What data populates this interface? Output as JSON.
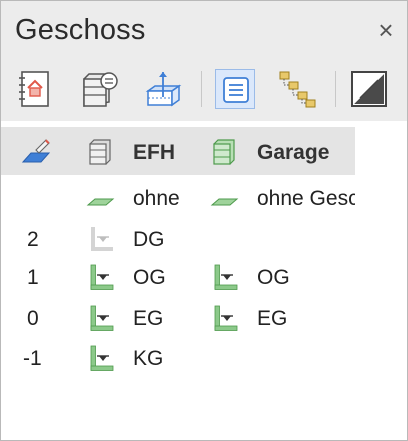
{
  "panel": {
    "title": "Geschoss",
    "close_icon": "×"
  },
  "toolbar": {
    "buttons": [
      {
        "name": "building-book-icon"
      },
      {
        "name": "floor-settings-icon"
      },
      {
        "name": "floor-height-icon"
      },
      {
        "name": "list-view-icon",
        "active": true
      },
      {
        "name": "tree-view-icon"
      },
      {
        "name": "contrast-icon"
      }
    ]
  },
  "columns": {
    "pencil_icon": "pencil-plane-icon",
    "col1": {
      "label": "EFH",
      "icon": "building-gray-icon"
    },
    "col2": {
      "label": "Garage",
      "icon": "building-green-icon"
    }
  },
  "rows": [
    {
      "number": "",
      "col1": "ohne",
      "col2": "ohne Geschoss"
    },
    {
      "number": "2",
      "col1": "DG",
      "col2": ""
    },
    {
      "number": "1",
      "col1": "OG",
      "col2": "OG"
    },
    {
      "number": "0",
      "col1": "EG",
      "col2": "EG"
    },
    {
      "number": "-1",
      "col1": "KG",
      "col2": ""
    }
  ],
  "colors": {
    "green": "#8cc98a",
    "green_dark": "#4e9a4c",
    "gray_icon": "#bdbdbd",
    "blue": "#3f7fd6"
  }
}
